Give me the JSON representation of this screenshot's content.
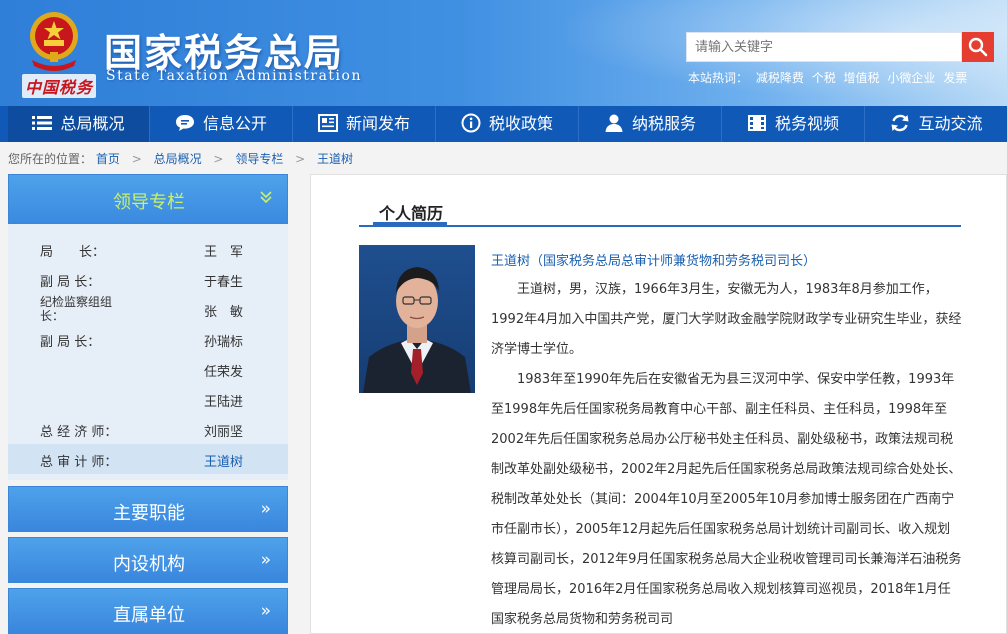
{
  "header": {
    "title": "国家税务总局",
    "subtitle": "State Taxation Administration",
    "brand_sign": "中国税务",
    "search_placeholder": "请输入关键字",
    "hotwords_label": "本站热词：",
    "hotwords": [
      "减税降费",
      "个税",
      "增值税",
      "小微企业",
      "发票"
    ]
  },
  "nav": [
    {
      "label": "总局概况",
      "icon": "menu-icon"
    },
    {
      "label": "信息公开",
      "icon": "chat-bubble-icon"
    },
    {
      "label": "新闻发布",
      "icon": "newspaper-icon"
    },
    {
      "label": "税收政策",
      "icon": "info-icon"
    },
    {
      "label": "纳税服务",
      "icon": "person-icon"
    },
    {
      "label": "税务视频",
      "icon": "video-icon"
    },
    {
      "label": "互动交流",
      "icon": "refresh-icon"
    }
  ],
  "breadcrumb": {
    "prefix": "您所在的位置：",
    "items": [
      "首页",
      "总局概况",
      "领导专栏",
      "王道树"
    ],
    "separator": ">"
  },
  "sidebar": {
    "head": "领导专栏",
    "leaders": [
      {
        "title": "局　　长：",
        "name": "王　军"
      },
      {
        "title": "副 局 长：",
        "name": "于春生"
      },
      {
        "title": "纪检监察组组　　长：",
        "name": "张　敏"
      },
      {
        "title": "副 局 长：",
        "name": "孙瑞标"
      },
      {
        "title": "",
        "name": "任荣发"
      },
      {
        "title": "",
        "name": "王陆进"
      },
      {
        "title": "总 经 济 师：",
        "name": "刘丽坚"
      },
      {
        "title": "总 审 计 师：",
        "name": "王道树"
      }
    ],
    "sections": [
      "主要职能",
      "内设机构",
      "直属单位"
    ]
  },
  "main": {
    "tab": "个人简历",
    "name_line": "王道树（国家税务总局总审计师兼货物和劳务税司司长）",
    "para1": "王道树，男，汉族，1966年3月生，安徽无为人，1983年8月参加工作，1992年4月加入中国共产党，厦门大学财政金融学院财政学专业研究生毕业，获经济学博士学位。",
    "para2": "1983年至1990年先后在安徽省无为县三汊河中学、保安中学任教，1993年至1998年先后任国家税务局教育中心干部、副主任科员、主任科员，1998年至2002年先后任国家税务总局办公厅秘书处主任科员、副处级秘书，政策法规司税制改革处副处级秘书，2002年2月起先后任国家税务总局政策法规司综合处处长、税制改革处处长（其间：2004年10月至2005年10月参加博士服务团在广西南宁市任副市长），2005年12月起先后任国家税务总局计划统计司副司长、收入规划核算司副司长，2012年9月任国家税务总局大企业税收管理司司长兼海洋石油税务管理局局长，2016年2月任国家税务总局收入规划核算司巡视员，2018年1月任国家税务总局货物和劳务税司司"
  },
  "colors": {
    "nav_bg": "#1059b6",
    "accent_link": "#1a5fb0",
    "search_btn": "#e53d2f",
    "sidebar_head_text": "#c9f06a"
  }
}
